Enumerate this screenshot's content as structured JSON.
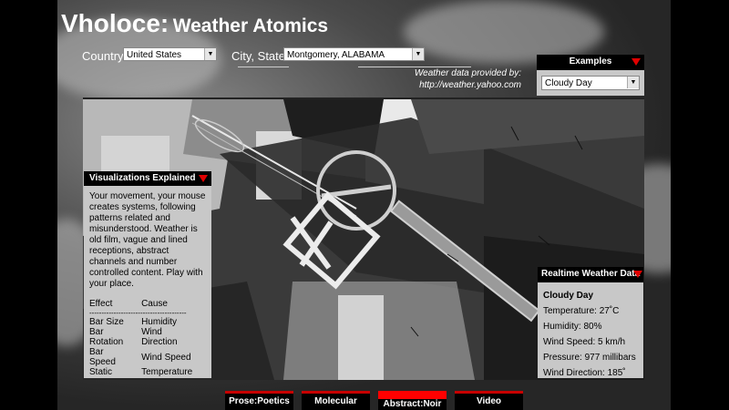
{
  "app": {
    "brand": "Vholoce:",
    "subtitle": "Weather Atomics"
  },
  "location": {
    "country_label": "Country:",
    "country_value": "United States",
    "city_label": "City, State:",
    "city_value": "Montgomery, ALABAMA"
  },
  "credit": {
    "line1": "Weather data provided by:",
    "line2": "http://weather.yahoo.com"
  },
  "examples": {
    "header": "Examples",
    "selected": "Cloudy Day"
  },
  "explain": {
    "header": "Visualizations Explained",
    "body": "Your movement, your mouse creates systems, following patterns related and misunderstood. Weather is old film, vague and lined receptions, abstract channels and number controlled content. Play with your place.",
    "col_effect": "Effect",
    "col_cause": "Cause",
    "divider": "----------------------------------------",
    "rows": [
      {
        "effect": "Bar Size",
        "cause": "Humidity"
      },
      {
        "effect": "Bar Rotation",
        "cause": "Wind Direction"
      },
      {
        "effect": "Bar Speed",
        "cause": "Wind Speed"
      },
      {
        "effect": "Static",
        "cause": "Temperature"
      }
    ]
  },
  "realtime": {
    "header": "Realtime Weather Data",
    "condition": "Cloudy Day",
    "temperature": "Temperature: 27˚C",
    "humidity": "Humidity: 80%",
    "wind_speed": "Wind Speed: 5 km/h",
    "pressure": "Pressure: 977 millibars",
    "wind_direction": "Wind Direction: 185˚"
  },
  "tabs": [
    {
      "label": "Prose:Poetics",
      "active": false
    },
    {
      "label": "Molecular",
      "active": false
    },
    {
      "label": "Abstract:Noir",
      "active": true
    },
    {
      "label": "Video",
      "active": false
    }
  ],
  "colors": {
    "accent": "#e00000",
    "panel": "#c8c8c8"
  }
}
